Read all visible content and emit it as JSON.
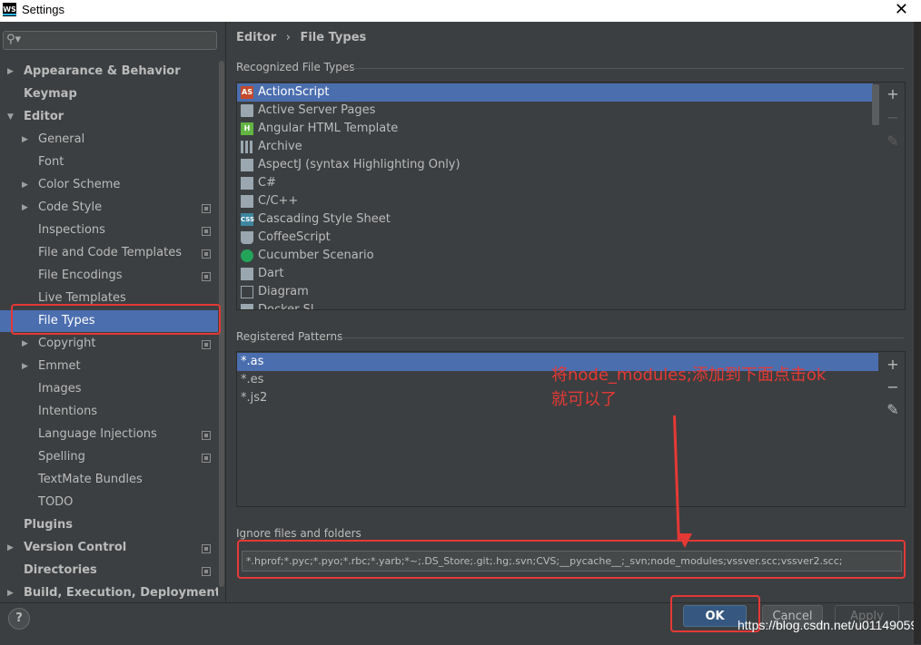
{
  "window": {
    "title": "Settings",
    "logo": "WS"
  },
  "sidebar": {
    "search_placeholder": "",
    "items": [
      {
        "label": "Appearance & Behavior"
      },
      {
        "label": "Keymap"
      },
      {
        "label": "Editor"
      },
      {
        "label": "General"
      },
      {
        "label": "Font"
      },
      {
        "label": "Color Scheme"
      },
      {
        "label": "Code Style"
      },
      {
        "label": "Inspections"
      },
      {
        "label": "File and Code Templates"
      },
      {
        "label": "File Encodings"
      },
      {
        "label": "Live Templates"
      },
      {
        "label": "File Types"
      },
      {
        "label": "Copyright"
      },
      {
        "label": "Emmet"
      },
      {
        "label": "Images"
      },
      {
        "label": "Intentions"
      },
      {
        "label": "Language Injections"
      },
      {
        "label": "Spelling"
      },
      {
        "label": "TextMate Bundles"
      },
      {
        "label": "TODO"
      },
      {
        "label": "Plugins"
      },
      {
        "label": "Version Control"
      },
      {
        "label": "Directories"
      },
      {
        "label": "Build, Execution, Deployment"
      }
    ]
  },
  "breadcrumb": {
    "parent": "Editor",
    "separator": "›",
    "current": "File Types"
  },
  "recognized": {
    "label": "Recognized File Types",
    "items": [
      {
        "label": "ActionScript",
        "icon": "AS"
      },
      {
        "label": "Active Server Pages",
        "icon": "file"
      },
      {
        "label": "Angular HTML Template",
        "icon": "H"
      },
      {
        "label": "Archive",
        "icon": "zip"
      },
      {
        "label": "AspectJ (syntax Highlighting Only)",
        "icon": "file"
      },
      {
        "label": "C#",
        "icon": "file"
      },
      {
        "label": "C/C++",
        "icon": "file"
      },
      {
        "label": "Cascading Style Sheet",
        "icon": "CSS"
      },
      {
        "label": "CoffeeScript",
        "icon": "cup"
      },
      {
        "label": "Cucumber Scenario",
        "icon": "leaf"
      },
      {
        "label": "Dart",
        "icon": "file"
      },
      {
        "label": "Diagram",
        "icon": "diag"
      },
      {
        "label": "Docker Sl...",
        "icon": "file"
      }
    ]
  },
  "patterns": {
    "label": "Registered Patterns",
    "items": [
      "*.as",
      "*.es",
      "*.js2"
    ]
  },
  "annotation": {
    "line1": "将node_modules;添加到下面点击ok",
    "line2": "就可以了"
  },
  "ignore": {
    "label": "Ignore files and folders",
    "value": "*.hprof;*.pyc;*.pyo;*.rbc;*.yarb;*~;.DS_Store;.git;.hg;.svn;CVS;__pycache__;_svn;node_modules;vssver.scc;vssver2.scc;"
  },
  "buttons": {
    "help": "?",
    "ok": "OK",
    "cancel": "Cancel",
    "apply": "Apply"
  },
  "watermark": "https://blog.csdn.net/u011490595",
  "colors": {
    "accent": "#4b6eaf",
    "annotation": "#e53935",
    "ok_button": "#365880"
  }
}
